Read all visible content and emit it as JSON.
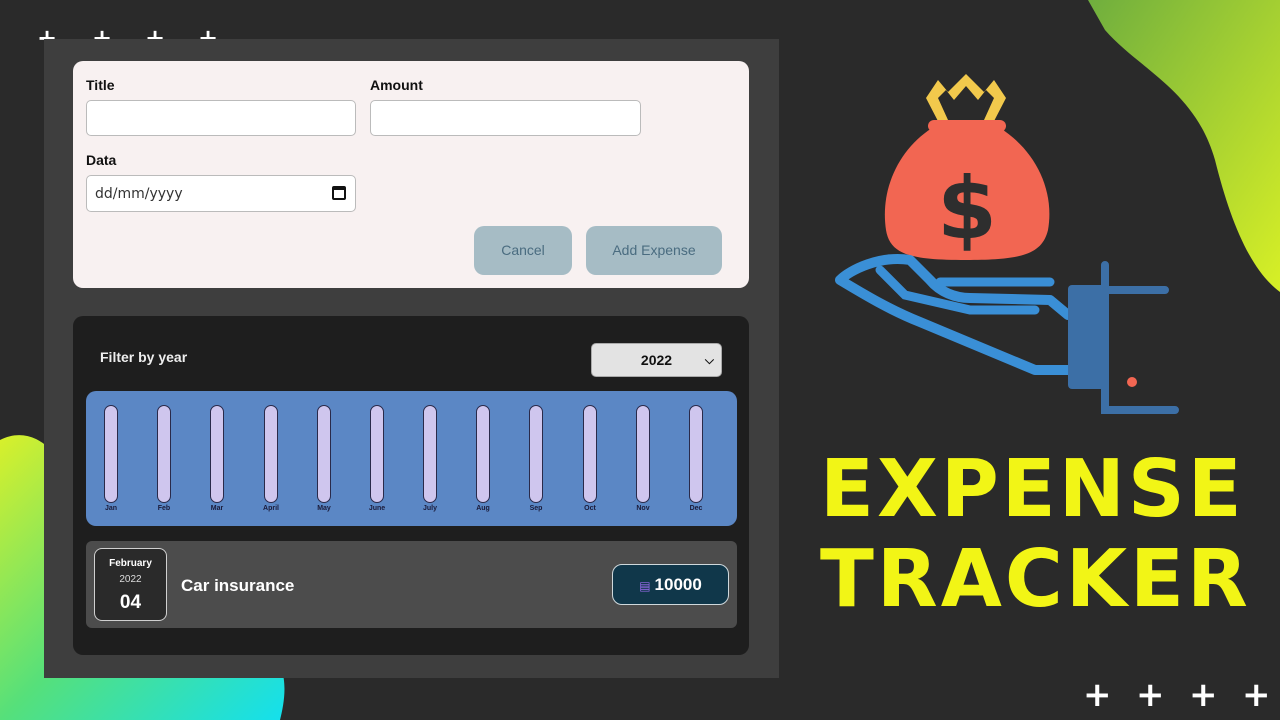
{
  "form": {
    "title_label": "Title",
    "title_value": "",
    "amount_label": "Amount",
    "amount_value": "",
    "date_label": "Data",
    "date_placeholder": "dd/mm/yyyy",
    "cancel_label": "Cancel",
    "add_label": "Add Expense"
  },
  "filter": {
    "label": "Filter by year",
    "selected_year": "2022"
  },
  "chart": {
    "months": [
      "Jan",
      "Feb",
      "Mar",
      "April",
      "May",
      "June",
      "July",
      "Aug",
      "Sep",
      "Oct",
      "Nov",
      "Dec"
    ],
    "fill_fractions": [
      0,
      0,
      0,
      0,
      0,
      0,
      0,
      0,
      0,
      0,
      0,
      0
    ]
  },
  "expenses": [
    {
      "month": "February",
      "year": "2022",
      "day": "04",
      "title": "Car insurance",
      "amount": "10000"
    }
  ],
  "brand": {
    "line1": "EXPENSE",
    "line2": "TRACKER"
  },
  "colors": {
    "background": "#2a2a2a",
    "accent_yellow": "#f2f516",
    "chart_blue": "#5b87c5",
    "bag_red": "#f26652",
    "hand_blue": "#3a8fd6"
  }
}
